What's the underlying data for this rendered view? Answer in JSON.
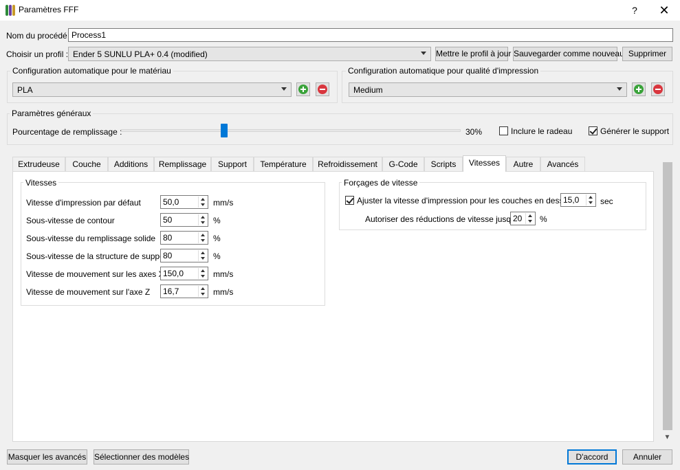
{
  "window": {
    "title": "Paramètres FFF",
    "help_label": "?",
    "close_label": "✕"
  },
  "process": {
    "label": "Nom du procédé :",
    "value": "Process1"
  },
  "profile": {
    "label": "Choisir un profil :",
    "selected": "Ender 5 SUNLU PLA+ 0.4 (modified)",
    "update_button": "Mettre le profil à jour",
    "save_new_button": "Sauvegarder comme nouveau",
    "delete_button": "Supprimer"
  },
  "material_config": {
    "group_label": "Configuration automatique pour le matériau",
    "selected": "PLA"
  },
  "quality_config": {
    "group_label": "Configuration automatique pour qualité d'impression",
    "selected": "Medium"
  },
  "general": {
    "group_label": "Paramètres généraux",
    "infill_label": "Pourcentage de remplissage :",
    "infill_value_text": "30%",
    "infill_fraction": 0.3,
    "raft_label": "Inclure le radeau",
    "raft_checked": false,
    "support_label": "Générer le support",
    "support_checked": true
  },
  "tabs": [
    "Extrudeuse",
    "Couche",
    "Additions",
    "Remplissage",
    "Support",
    "Température",
    "Refroidissement",
    "G-Code",
    "Scripts",
    "Vitesses",
    "Autre",
    "Avancés"
  ],
  "active_tab": "Vitesses",
  "speeds": {
    "group_label": "Vitesses",
    "rows": [
      {
        "label": "Vitesse d'impression par défaut",
        "value": "50,0",
        "unit": "mm/s"
      },
      {
        "label": "Sous-vitesse de contour",
        "value": "50",
        "unit": "%"
      },
      {
        "label": "Sous-vitesse du remplissage solide",
        "value": "80",
        "unit": "%"
      },
      {
        "label": "Sous-vitesse de la structure de support",
        "value": "80",
        "unit": "%"
      },
      {
        "label": "Vitesse de mouvement sur les axes X/Y",
        "value": "150,0",
        "unit": "mm/s"
      },
      {
        "label": "Vitesse de mouvement sur l'axe Z",
        "value": "16,7",
        "unit": "mm/s"
      }
    ]
  },
  "overrides": {
    "group_label": "Forçages de vitesse",
    "adjust_label": "Ajuster la vitesse d'impression pour les couches en dessous",
    "adjust_checked": true,
    "adjust_value": "15,0",
    "adjust_unit": "sec",
    "reduction_label": "Autoriser des réductions de vitesse jusqu'à",
    "reduction_value": "20",
    "reduction_unit": "%"
  },
  "footer": {
    "hide_advanced": "Masquer les avancés",
    "select_models": "Sélectionner des modèles",
    "ok": "D'accord",
    "cancel": "Annuler"
  },
  "colors": {
    "accent": "#0078d7",
    "add": "#3aa33a",
    "remove": "#d9363e"
  }
}
